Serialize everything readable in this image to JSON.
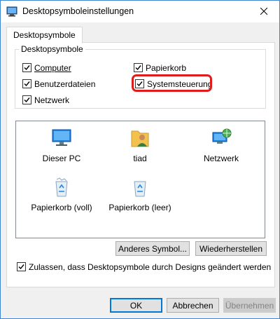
{
  "window": {
    "title": "Desktopsymboleinstellungen"
  },
  "tabs": [
    {
      "label": "Desktopsymbole"
    }
  ],
  "group": {
    "legend": "Desktopsymbole",
    "checkboxes": [
      {
        "label": "Computer",
        "checked": true
      },
      {
        "label": "Papierkorb",
        "checked": true
      },
      {
        "label": "Benutzerdateien",
        "checked": true
      },
      {
        "label": "Systemsteuerung",
        "checked": true
      },
      {
        "label": "Netzwerk",
        "checked": true
      }
    ]
  },
  "icons": [
    {
      "label": "Dieser PC",
      "icon": "this-pc-icon"
    },
    {
      "label": "tiad",
      "icon": "user-folder-icon"
    },
    {
      "label": "Netzwerk",
      "icon": "network-icon"
    },
    {
      "label": "Papierkorb (voll)",
      "icon": "recycle-bin-full-icon"
    },
    {
      "label": "Papierkorb (leer)",
      "icon": "recycle-bin-empty-icon"
    }
  ],
  "buttons": {
    "change_icon": "Anderes Symbol...",
    "restore": "Wiederherstellen",
    "ok": "OK",
    "cancel": "Abbrechen",
    "apply": "Übernehmen"
  },
  "themes_checkbox": {
    "label": "Zulassen, dass Desktopsymbole durch Designs geändert werden",
    "checked": true
  },
  "colors": {
    "highlight": "#e01b1b",
    "accent": "#0078d7"
  }
}
